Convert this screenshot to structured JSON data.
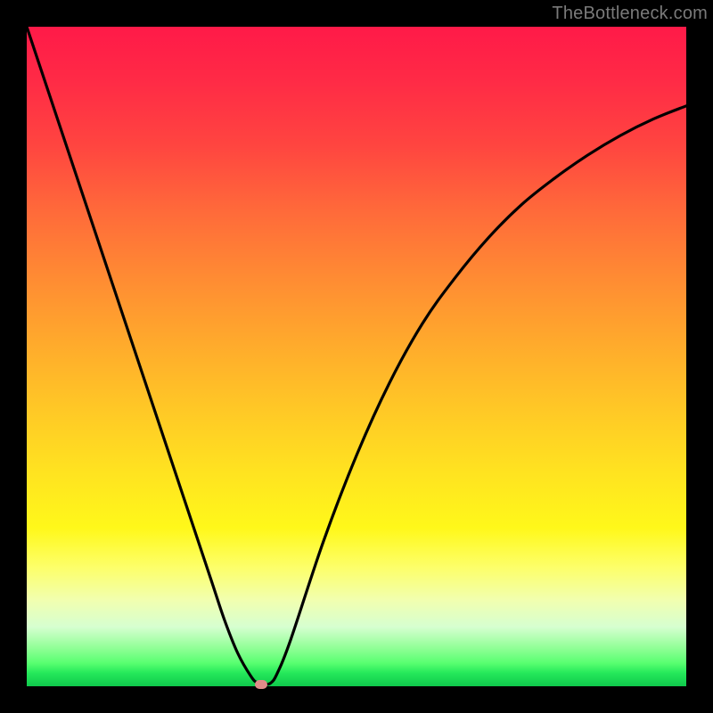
{
  "watermark": "TheBottleneck.com",
  "colors": {
    "frame": "#000000",
    "curve": "#000000",
    "marker": "#df8b89",
    "gradient_top": "#ff1a48",
    "gradient_bottom": "#0fc94c"
  },
  "chart_data": {
    "type": "line",
    "title": "",
    "xlabel": "",
    "ylabel": "",
    "xlim": [
      0,
      100
    ],
    "ylim": [
      0,
      100
    ],
    "grid": false,
    "legend": false,
    "series": [
      {
        "name": "bottleneck-curve",
        "x": [
          0,
          5,
          10,
          15,
          20,
          25,
          28,
          30,
          32,
          34,
          35,
          36,
          37,
          38,
          40,
          45,
          50,
          55,
          60,
          65,
          70,
          75,
          80,
          85,
          90,
          95,
          100
        ],
        "y": [
          100,
          85,
          70,
          55,
          40,
          25,
          16,
          10,
          5,
          1.5,
          0.5,
          0.3,
          0.5,
          2,
          7,
          22,
          35,
          46,
          55,
          62,
          68,
          73,
          77,
          80.5,
          83.5,
          86,
          88
        ]
      }
    ],
    "marker": {
      "x": 35.5,
      "y": 0.3
    }
  }
}
